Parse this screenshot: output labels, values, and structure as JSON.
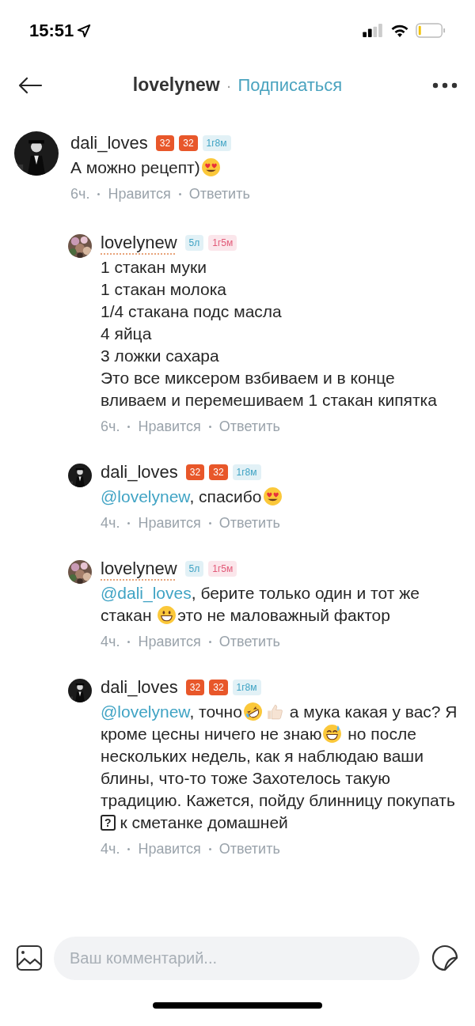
{
  "status_bar": {
    "time": "15:51"
  },
  "header": {
    "title": "lovelynew",
    "separator": "·",
    "action": "Подписаться"
  },
  "comments": [
    {
      "author": "dali_loves",
      "underlined": false,
      "avatar": {
        "kind": "dark"
      },
      "badges": [
        {
          "text": "32",
          "kind": "solid",
          "color": "#e8572a"
        },
        {
          "text": "32",
          "kind": "solid",
          "color": "#e8572a"
        },
        {
          "text": "1г8м",
          "kind": "soft",
          "color": "#3fa3c4"
        }
      ],
      "body": [
        {
          "kind": "text",
          "text": "А можно рецепт)"
        },
        {
          "kind": "heart_eyes"
        }
      ],
      "meta": {
        "time": "6ч.",
        "like": "Нравится",
        "reply": "Ответить"
      },
      "children": [
        {
          "author": "lovelynew",
          "underlined": true,
          "avatar": {
            "kind": "floral"
          },
          "badges": [
            {
              "text": "5л",
              "kind": "soft",
              "color": "#3fa3c4"
            },
            {
              "text": "1г5м",
              "kind": "soft",
              "color": "#e25a78"
            }
          ],
          "body": [
            {
              "kind": "text",
              "text": "1 стакан муки\n1 стакан молока\n1/4 стакана подс масла\n4 яйца\n3 ложки сахара\nЭто все миксером взбиваем и в конце вливаем и перемешиваем 1 стакан кипятка"
            }
          ],
          "meta": {
            "time": "6ч.",
            "like": "Нравится",
            "reply": "Ответить"
          }
        },
        {
          "author": "dali_loves",
          "underlined": false,
          "avatar": {
            "kind": "dark"
          },
          "badges": [
            {
              "text": "32",
              "kind": "solid",
              "color": "#e8572a"
            },
            {
              "text": "32",
              "kind": "solid",
              "color": "#e8572a"
            },
            {
              "text": "1г8м",
              "kind": "soft",
              "color": "#3fa3c4"
            }
          ],
          "body": [
            {
              "kind": "mention",
              "text": "@lovelynew"
            },
            {
              "kind": "text",
              "text": ", спасибо"
            },
            {
              "kind": "heart_eyes"
            }
          ],
          "meta": {
            "time": "4ч.",
            "like": "Нравится",
            "reply": "Ответить"
          }
        },
        {
          "author": "lovelynew",
          "underlined": true,
          "avatar": {
            "kind": "floral"
          },
          "badges": [
            {
              "text": "5л",
              "kind": "soft",
              "color": "#3fa3c4"
            },
            {
              "text": "1г5м",
              "kind": "soft",
              "color": "#e25a78"
            }
          ],
          "body": [
            {
              "kind": "mention",
              "text": "@dali_loves"
            },
            {
              "kind": "text",
              "text": ", берите только один и тот же стакан "
            },
            {
              "kind": "grin"
            },
            {
              "kind": "text",
              "text": "это не маловажный фактор"
            }
          ],
          "meta": {
            "time": "4ч.",
            "like": "Нравится",
            "reply": "Ответить"
          }
        },
        {
          "author": "dali_loves",
          "underlined": false,
          "avatar": {
            "kind": "dark"
          },
          "badges": [
            {
              "text": "32",
              "kind": "solid",
              "color": "#e8572a"
            },
            {
              "text": "32",
              "kind": "solid",
              "color": "#e8572a"
            },
            {
              "text": "1г8м",
              "kind": "soft",
              "color": "#3fa3c4"
            }
          ],
          "body": [
            {
              "kind": "mention",
              "text": "@lovelynew"
            },
            {
              "kind": "text",
              "text": ", точно"
            },
            {
              "kind": "rofl"
            },
            {
              "kind": "thumbs_up"
            },
            {
              "kind": "text",
              "text": " а мука какая у вас? Я кроме цесны ничего не знаю"
            },
            {
              "kind": "sweat_smile"
            },
            {
              "kind": "text",
              "text": " но после нескольких недель, как я наблюдаю ваши блины, что-то тоже Захотелось такую традицию. Кажется, пойду блинницу покупать"
            },
            {
              "kind": "glyph",
              "text": "?"
            },
            {
              "kind": "text",
              "text": " к сметанке домашней"
            }
          ],
          "meta": {
            "time": "4ч.",
            "like": "Нравится",
            "reply": "Ответить"
          }
        }
      ]
    }
  ],
  "composer": {
    "placeholder": "Ваш комментарий..."
  }
}
